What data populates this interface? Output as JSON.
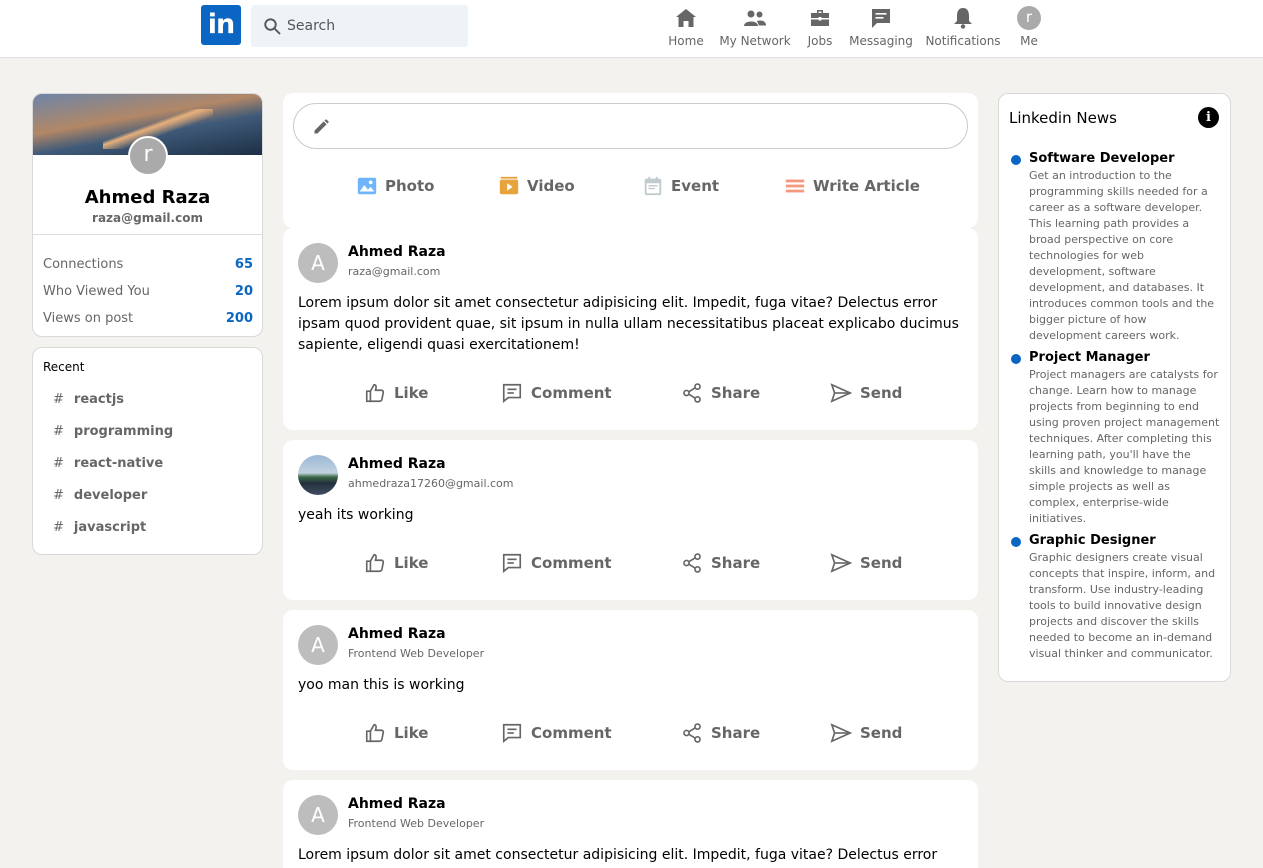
{
  "header": {
    "logo_text": "in",
    "search_placeholder": "Search",
    "nav": [
      {
        "label": "Home",
        "icon": "home-icon"
      },
      {
        "label": "My Network",
        "icon": "network-icon"
      },
      {
        "label": "Jobs",
        "icon": "briefcase-icon"
      },
      {
        "label": "Messaging",
        "icon": "message-icon"
      },
      {
        "label": "Notifications",
        "icon": "bell-icon"
      },
      {
        "label": "Me",
        "icon": "avatar"
      }
    ],
    "me_initial": "r"
  },
  "profile": {
    "initial": "r",
    "name": "Ahmed Raza",
    "email": "raza@gmail.com",
    "stats": [
      {
        "label": "Connections",
        "value": "65"
      },
      {
        "label": "Who Viewed You",
        "value": "20"
      },
      {
        "label": "Views on post",
        "value": "200"
      }
    ]
  },
  "recent": {
    "title": "Recent",
    "hash": "#",
    "tags": [
      "reactjs",
      "programming",
      "react-native",
      "developer",
      "javascript"
    ]
  },
  "composer": {
    "options": [
      {
        "label": "Photo",
        "color": "#70b5f9"
      },
      {
        "label": "Video",
        "color": "#e7a33e"
      },
      {
        "label": "Event",
        "color": "#c0cbcd"
      },
      {
        "label": "Write Article",
        "color": "#f5987e"
      }
    ]
  },
  "actions": {
    "like": "Like",
    "comment": "Comment",
    "share": "Share",
    "send": "Send"
  },
  "posts": [
    {
      "initial": "A",
      "name": "Ahmed Raza",
      "sub": "raza@gmail.com",
      "text": "Lorem ipsum dolor sit amet consectetur adipisicing elit. Impedit, fuga vitae? Delectus error ipsam quod provident quae, sit ipsum in nulla ullam necessitatibus placeat explicabo ducimus sapiente, eligendi quasi exercitationem!"
    },
    {
      "initial": "",
      "name": "Ahmed Raza",
      "sub": "ahmedraza17260@gmail.com",
      "text": "yeah its working"
    },
    {
      "initial": "A",
      "name": "Ahmed Raza",
      "sub": "Frontend Web Developer",
      "text": "yoo man this is working"
    },
    {
      "initial": "A",
      "name": "Ahmed Raza",
      "sub": "Frontend Web Developer",
      "text": "Lorem ipsum dolor sit amet consectetur adipisicing elit. Impedit, fuga vitae? Delectus error ipsam quod provident quae, sit ipsum in nulla ullam necessitatibus placeat explicabo ducimus sapiente, eligendi quasi exercitationem!"
    }
  ],
  "news": {
    "title": "Linkedin News",
    "info": "i",
    "items": [
      {
        "head": "Software Developer",
        "desc": "Get an introduction to the programming skills needed for a career as a software developer. This learning path provides a broad perspective on core technologies for web development, software development, and databases. It introduces common tools and the bigger picture of how development careers work."
      },
      {
        "head": "Project Manager",
        "desc": "Project managers are catalysts for change. Learn how to manage projects from beginning to end using proven project management techniques. After completing this learning path, you'll have the skills and knowledge to manage simple projects as well as complex, enterprise-wide initiatives."
      },
      {
        "head": "Graphic Designer",
        "desc": "Graphic designers create visual concepts that inspire, inform, and transform. Use industry-leading tools to build innovative design projects and discover the skills needed to become an in-demand visual thinker and communicator."
      }
    ]
  }
}
